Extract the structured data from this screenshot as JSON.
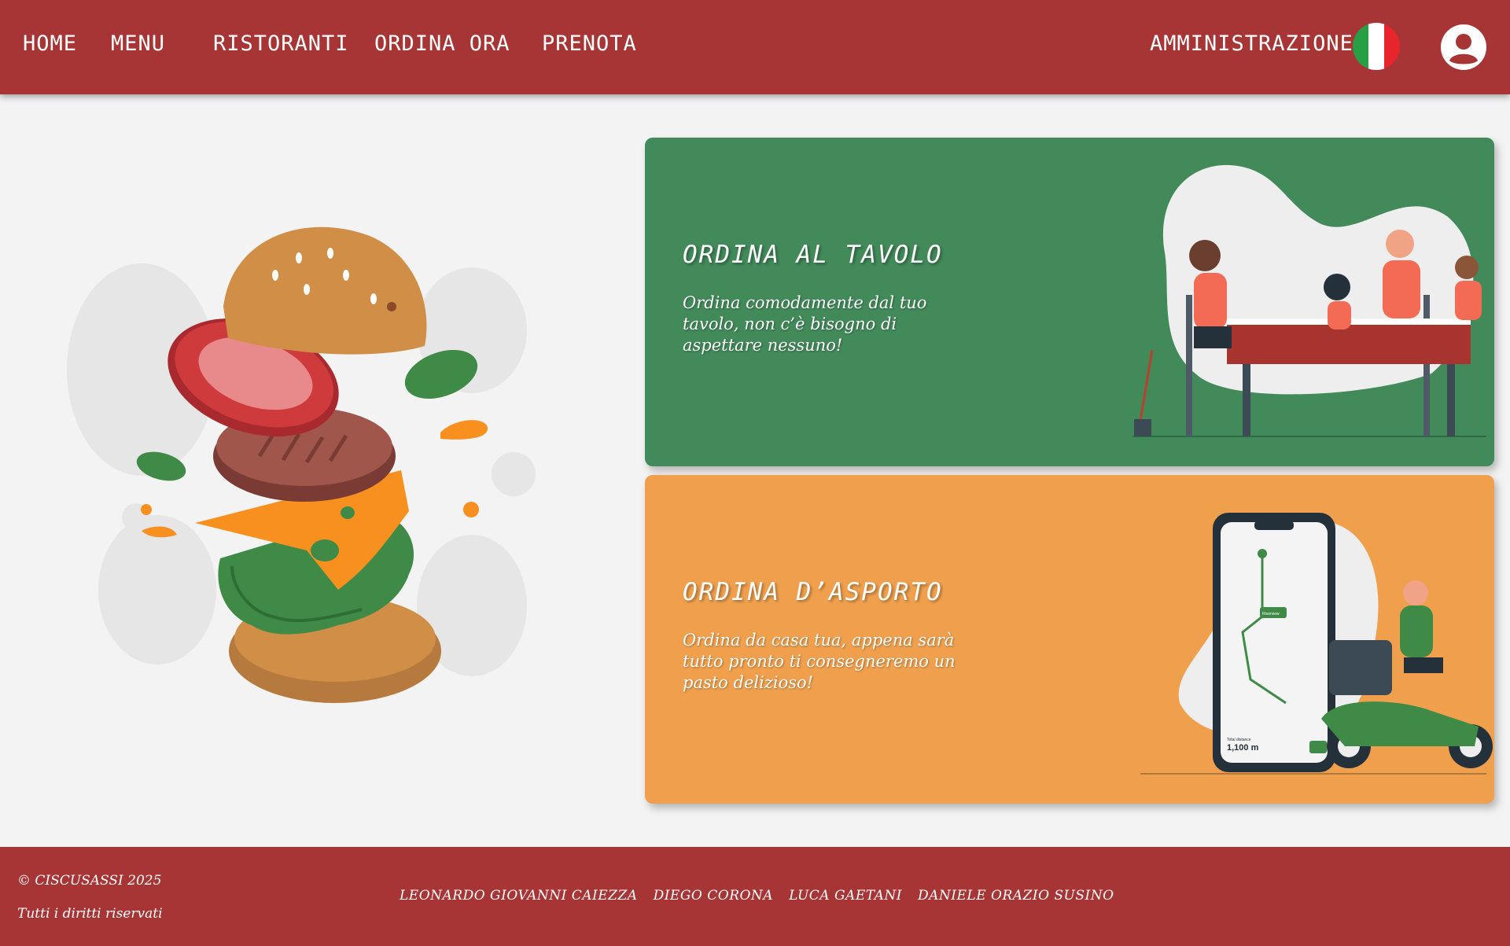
{
  "nav": {
    "home": "HOME",
    "menu": "MENU",
    "ristoranti": "RISTORANTI",
    "ordina_ora": "ORDINA ORA",
    "prenota": "PRENOTA",
    "amministrazione": "AMMINISTRAZIONE",
    "language_icon": "italian-flag-icon",
    "user_icon": "user-account-icon"
  },
  "cards": [
    {
      "title": "ORDINA AL TAVOLO",
      "text": "Ordina comodamente dal tuo tavolo, non c’è bisogno di aspettare nessuno!",
      "color": "#428a5a"
    },
    {
      "title": "ORDINA D’ASPORTO",
      "text": "Ordina da casa tua, appena sarà tutto pronto ti consegneremo un pasto delizioso!",
      "color": "#f0a04d",
      "phone_distance": "1,100 m",
      "phone_distance_label": "Total distance",
      "phone_map_tag": "Riverview"
    }
  ],
  "footer": {
    "copyright": "© CISCUSASSI 2025",
    "rights": "Tutti i diritti riservati",
    "authors": [
      "LEONARDO GIOVANNI CAIEZZA",
      "DIEGO CORONA",
      "LUCA GAETANI",
      "DANIELE ORAZIO SUSINO"
    ]
  },
  "colors": {
    "brand_red": "#a83535",
    "background": "#f3f3f4",
    "flag": [
      "#27a045",
      "#ffffff",
      "#e8242c"
    ]
  }
}
